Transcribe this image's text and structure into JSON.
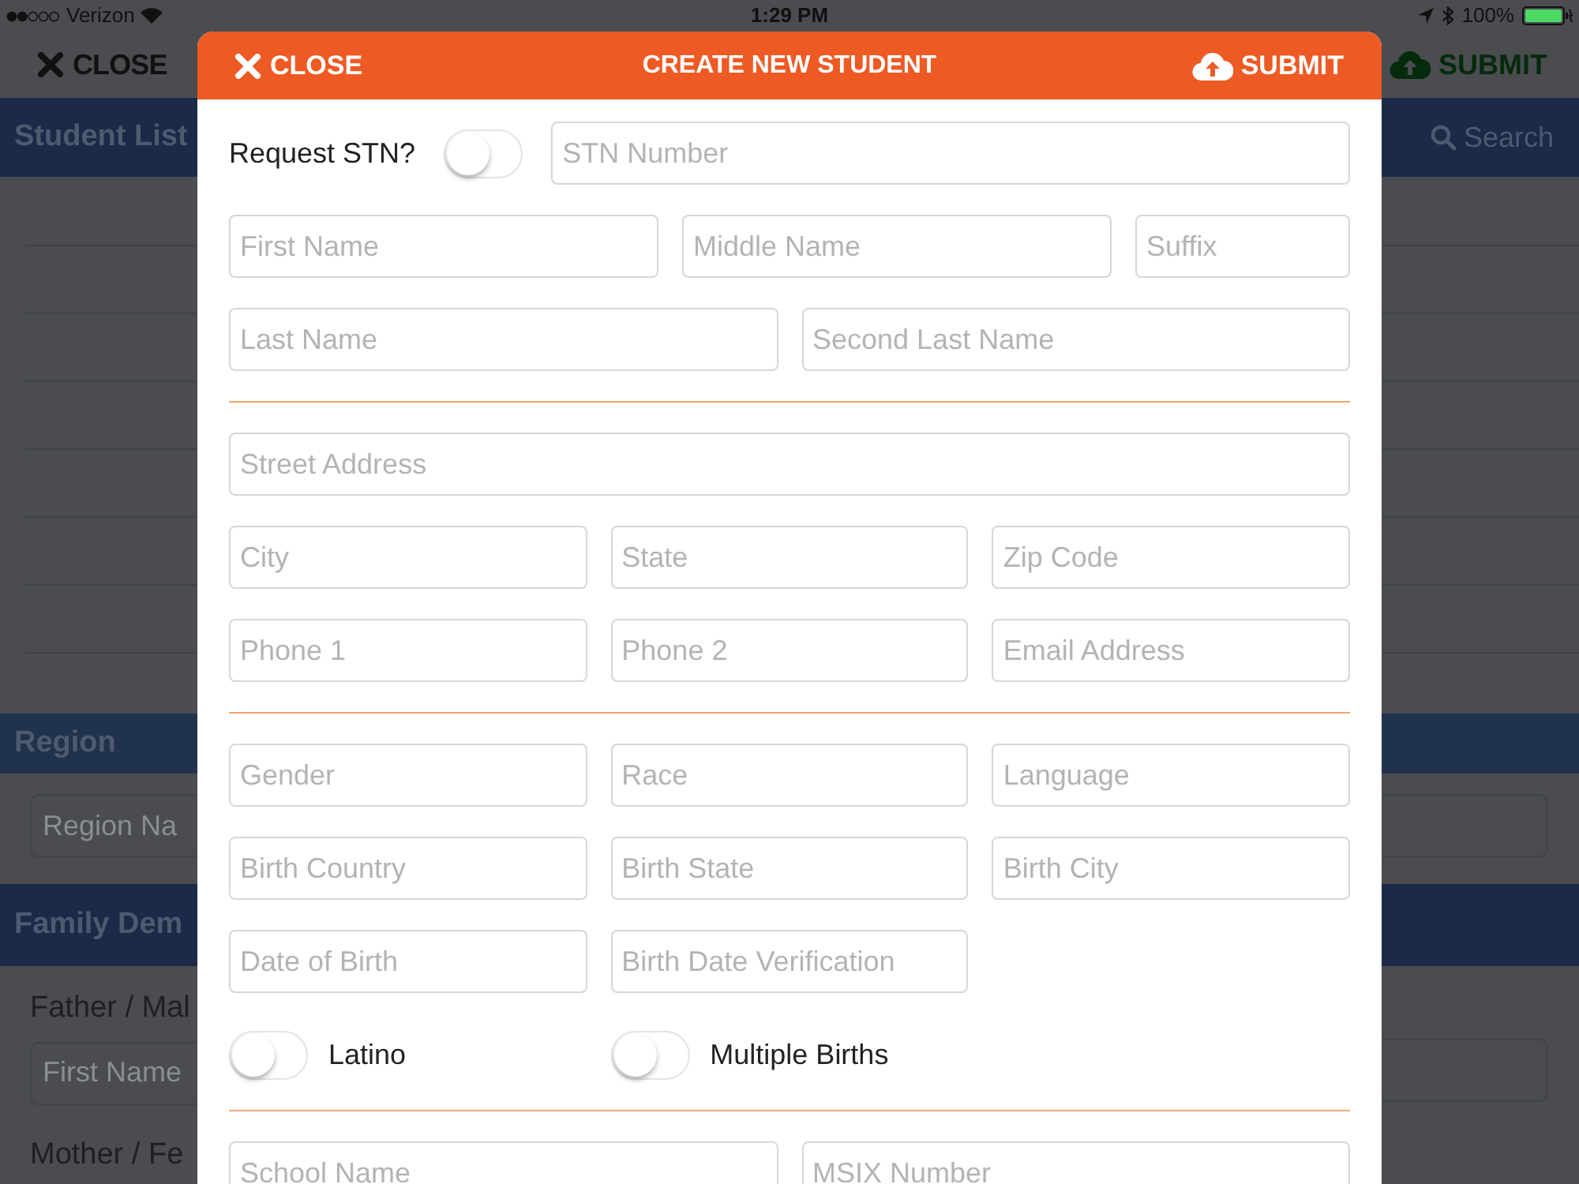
{
  "status_bar": {
    "carrier": "Verizon",
    "time": "1:29 PM",
    "battery": "100%"
  },
  "background": {
    "close_button": "CLOSE",
    "submit_button": "SUBMIT",
    "header_title": "Student List",
    "search": "Search",
    "region_header": "Region",
    "region_field": {
      "placeholder": "Region Na"
    },
    "family_header": "Family Dem",
    "father_label": "Father / Mal",
    "father_field": {
      "placeholder": "First Name"
    },
    "mother_label": "Mother / Fe"
  },
  "modal": {
    "close_button": "CLOSE",
    "title": "CREATE NEW STUDENT",
    "submit_button": "SUBMIT",
    "sections": [
      {
        "rows": [
          {
            "kind": "stn",
            "label": "Request STN?",
            "on": false,
            "fields": [
              {
                "placeholder": "STN Number"
              }
            ]
          },
          {
            "kind": "names",
            "fields": [
              {
                "placeholder": "First Name"
              },
              {
                "placeholder": "Middle Name"
              },
              {
                "placeholder": "Suffix"
              }
            ]
          },
          {
            "kind": "pair",
            "fields": [
              {
                "placeholder": "Last Name"
              },
              {
                "placeholder": "Second Last Name"
              }
            ]
          }
        ]
      },
      {
        "rows": [
          {
            "kind": "single",
            "fields": [
              {
                "placeholder": "Street Address"
              }
            ]
          },
          {
            "kind": "triple",
            "fields": [
              {
                "placeholder": "City"
              },
              {
                "placeholder": "State"
              },
              {
                "placeholder": "Zip Code"
              }
            ]
          },
          {
            "kind": "triple",
            "fields": [
              {
                "placeholder": "Phone 1"
              },
              {
                "placeholder": "Phone 2"
              },
              {
                "placeholder": "Email Address"
              }
            ]
          }
        ]
      },
      {
        "rows": [
          {
            "kind": "triple",
            "fields": [
              {
                "placeholder": "Gender"
              },
              {
                "placeholder": "Race"
              },
              {
                "placeholder": "Language"
              }
            ]
          },
          {
            "kind": "triple",
            "fields": [
              {
                "placeholder": "Birth Country"
              },
              {
                "placeholder": "Birth State"
              },
              {
                "placeholder": "Birth City"
              }
            ]
          },
          {
            "kind": "triple",
            "fields": [
              {
                "placeholder": "Date of Birth"
              },
              {
                "placeholder": "Birth Date Verification"
              }
            ]
          },
          {
            "kind": "toggles",
            "toggles": [
              {
                "label": "Latino",
                "on": false
              },
              {
                "label": "Multiple Births",
                "on": false
              }
            ]
          }
        ]
      },
      {
        "rows": [
          {
            "kind": "pair",
            "fields": [
              {
                "placeholder": "School Name"
              },
              {
                "placeholder": "MSIX Number"
              }
            ]
          }
        ]
      }
    ]
  }
}
